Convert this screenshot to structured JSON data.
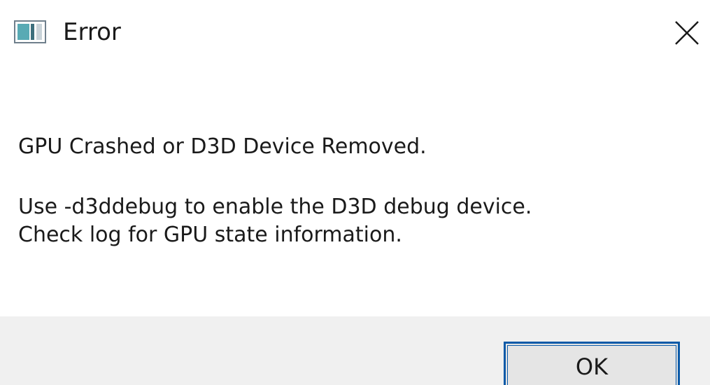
{
  "window": {
    "title": "Error",
    "icon": "app-window-icon",
    "close_icon": "close-icon"
  },
  "message": {
    "line1": "GPU Crashed or D3D Device Removed.",
    "line2": "Use -d3ddebug to enable the D3D debug device.",
    "line3": "Check log for GPU state information."
  },
  "buttons": {
    "ok_label": "OK"
  },
  "colors": {
    "accent": "#0b5aa8",
    "footer_bg": "#f0f0f0",
    "text": "#1a1a1a"
  }
}
